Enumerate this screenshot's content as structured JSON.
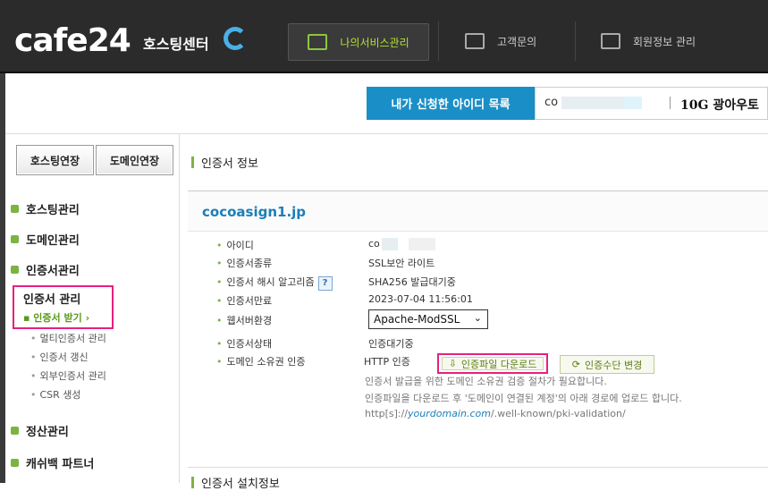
{
  "header": {
    "logo": "cafe24",
    "logo_sub": "호스팅센터",
    "nav": [
      {
        "label": "나의서비스관리",
        "icon": "my-service-icon",
        "active": true
      },
      {
        "label": "고객문의",
        "icon": "customer-inquiry-icon",
        "active": false
      },
      {
        "label": "회원정보 관리",
        "icon": "member-info-icon",
        "active": false
      }
    ]
  },
  "idbar": {
    "label": "내가 신청한 아이디 목록",
    "id_visible": "co",
    "plan": "10G 광아우토"
  },
  "sidebar": {
    "buttons": [
      "호스팅연장",
      "도메인연장"
    ],
    "groups": [
      "호스팅관리",
      "도메인관리",
      "인증서관리",
      "정산관리",
      "캐쉬백 파트너"
    ],
    "cert_menu_title": "인증서 관리",
    "cert_active": "인증서 받기",
    "cert_items": [
      "멀티인증서 관리",
      "인증서 갱신",
      "외부인증서 관리",
      "CSR 생성"
    ]
  },
  "main": {
    "section_title": "인증서 정보",
    "domain": "cocoasign1.jp",
    "rows": [
      {
        "key": "아이디",
        "value": "co"
      },
      {
        "key": "인증서종류",
        "value": "SSL보안 라이트"
      },
      {
        "key": "인증서 해시 알고리즘",
        "value": "SHA256 발급대기중",
        "help": "?"
      },
      {
        "key": "인증서만료",
        "value": "2023-07-04 11:56:01"
      },
      {
        "key": "웹서버환경",
        "value": "Apache-ModSSL"
      },
      {
        "key": "인증서상태",
        "value": "인증대기중"
      },
      {
        "key": "도메인 소유권 인증",
        "value": "HTTP 인증"
      }
    ],
    "download_button": "인증파일 다운로드",
    "change_button": "인증수단 변경",
    "notes": [
      "인증서 발급을 위한 도메인 소유권 검증 절차가 필요합니다.",
      "인증파일을 다운로드 후 '도메인이 연결된 계정'의 아래 경로에 업로드 합니다."
    ],
    "path_prefix": "http[s]://",
    "path_domain": "yourdomain.com",
    "path_suffix": "/.well-known/pki-validation/",
    "next_section": "인증서 설치정보"
  },
  "colors": {
    "accent": "#1a8fc7",
    "green": "#7cb342",
    "highlight": "#e8207e"
  }
}
